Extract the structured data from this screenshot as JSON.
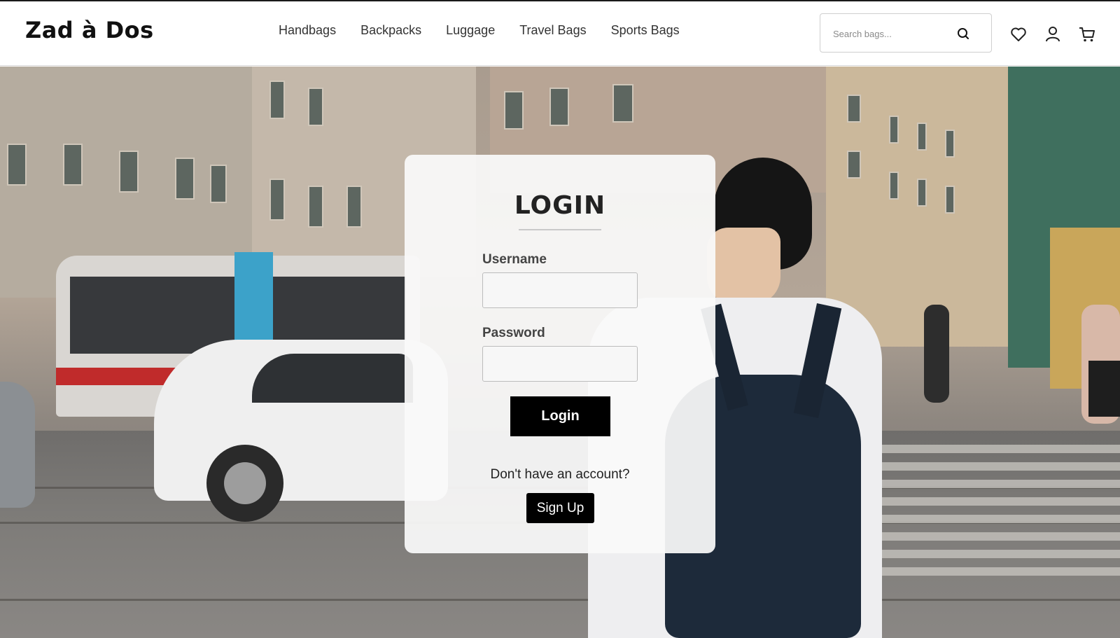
{
  "brand": {
    "name": "Zad à Dos"
  },
  "nav": {
    "items": [
      {
        "label": "Handbags"
      },
      {
        "label": "Backpacks"
      },
      {
        "label": "Luggage"
      },
      {
        "label": "Travel Bags"
      },
      {
        "label": "Sports Bags"
      }
    ]
  },
  "search": {
    "placeholder": "Search bags...",
    "value": "",
    "icon": "search-icon"
  },
  "header_icons": [
    "heart-icon",
    "user-icon",
    "cart-icon"
  ],
  "login": {
    "title": "LOGIN",
    "username_label": "Username",
    "username_value": "",
    "password_label": "Password",
    "password_value": "",
    "submit_label": "Login",
    "signup_prompt": "Don't have an account?",
    "signup_label": "Sign Up"
  },
  "colors": {
    "primary_button": "#000000",
    "text": "#222222",
    "card_background": "#fafafa"
  }
}
